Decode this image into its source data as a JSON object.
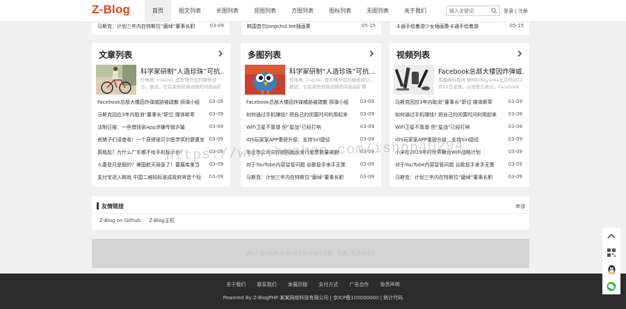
{
  "brand": {
    "logo": "Z-Blog",
    "accent": "#e8431c"
  },
  "nav": [
    {
      "label": "首页",
      "active": true
    },
    {
      "label": "图文列表"
    },
    {
      "label": "长图列表"
    },
    {
      "label": "竖图列表"
    },
    {
      "label": "方图列表"
    },
    {
      "label": "图标列表"
    },
    {
      "label": "无图列表"
    },
    {
      "label": "关于我们"
    }
  ],
  "search": {
    "placeholder": "输入关键词",
    "icon": "search-icon"
  },
  "login_text": "登录 | 注册",
  "top_strip": [
    {
      "title": "马斯克：计划三年内在特斯拉“磨绰”董事长职",
      "date": "03-09"
    },
    {
      "title": "韩国首尔Jongchul lee插画集",
      "date": "05-15"
    },
    {
      "title": "卡通手绘着游少女插画集卡通手绘着游",
      "date": "05-15"
    }
  ],
  "panels": [
    {
      "title": "文章列表",
      "feature_title": "科学家研制“人造珍珠”可抗...",
      "feature_desc": "珍珠质（nacre）是珍珠外层的硬质部分。据说，它在某些软体动物的内部由矿物",
      "items": [
        {
          "title": "Facebook总部大楼因炸弹威胁被疏散 拆弹小组",
          "date": "03-09"
        },
        {
          "title": "马斯克回应3年内取消“董事长”职位 媒体断章",
          "date": "03-09"
        },
        {
          "title": "法制日报：一些借钱张App涉嫌传销诈骗",
          "date": "03-09"
        },
        {
          "title": "丧猪子们请查收！一个获得诺贝尔医学奖的健康忠",
          "date": "03-09"
        },
        {
          "title": "真尴尬？为什么广东都不给手机标示价？",
          "date": "03-09"
        },
        {
          "title": "人委登月是假的？美国航天局急了！要展库里当",
          "date": "03-09"
        },
        {
          "title": "支付宝进入韩戏 中国二维码标准成政府将首个标",
          "date": "03-09"
        }
      ]
    },
    {
      "title": "多图列表",
      "feature_title": "科学家研制“人造珍珠”可抗...",
      "feature_desc": "珍珠质（nacre）是珍珠外层的硬质部分。据说，它在某些软体动物的内部由矿物",
      "items": [
        {
          "title": "Facebook总部大楼因炸弹威胁被疏散 拆弹小组",
          "date": "03-09"
        },
        {
          "title": "如何通过手机赚钱? 把自己的闲置时间利用起来",
          "date": "03-09"
        },
        {
          "title": "WiFi卫星不靠谱 但“星战”已经打响",
          "date": "03-09"
        },
        {
          "title": "iOS玩家家APP重磅升级：支持Siri捷径",
          "date": "03-09"
        },
        {
          "title": "车企市公司向你收购股份发行股票数量被删",
          "date": "03-09"
        },
        {
          "title": "对于YouTube内容监管问题 谷歌投手来手无策",
          "date": "03-09"
        },
        {
          "title": "马斯克：计划三年内在特斯拉“磨绰”董事长职",
          "date": "03-09"
        }
      ]
    },
    {
      "title": "视频列表",
      "feature_title": "Facebook总部大楼因炸弹威...",
      "feature_desc": "凤凰网科技讯 据NBcBayarea北京时间12月12日凌晨，当地警方表示，Facebook",
      "items": [
        {
          "title": "马斯克回应3年内取消“董事长”职位 媒体断章",
          "date": "03-09"
        },
        {
          "title": "如何通过手机赚钱? 把自己的闲置时间利用起来",
          "date": "03-09"
        },
        {
          "title": "WiFi卫星不靠谱 但“星战”已经打响",
          "date": "03-09"
        },
        {
          "title": "iOS玩家家APP重磅升级：支持Siri捷径",
          "date": "03-09"
        },
        {
          "title": "小米在2019年的世界舞台WiFi战略计划",
          "date": "03-09"
        },
        {
          "title": "对于YouTube内容监管问题 谷歌投手来手无策",
          "date": "03-09"
        },
        {
          "title": "马斯克：计划三年内在特斯拉“磨绰”董事长职",
          "date": "03-09"
        }
      ]
    }
  ],
  "friends": {
    "title": "友情链接",
    "apply": "申请",
    "links": [
      "Z-Blog on Github",
      "Z-Blog主机"
    ]
  },
  "ad": {
    "text": "通栏广告 1180 X 80 可在后台自行设置，高度，宽度自适应"
  },
  "footer": {
    "links": [
      "关于我们",
      "联系我们",
      "发展历程",
      "支付方式",
      "广告合作",
      "免责声明"
    ],
    "copyright": "Powered By Z-BlogPHP 某某网络科技有限公司 | 京ICP备100000000 | 统计代码"
  },
  "watermark": "https://www.huzhan.com/ishop40294"
}
